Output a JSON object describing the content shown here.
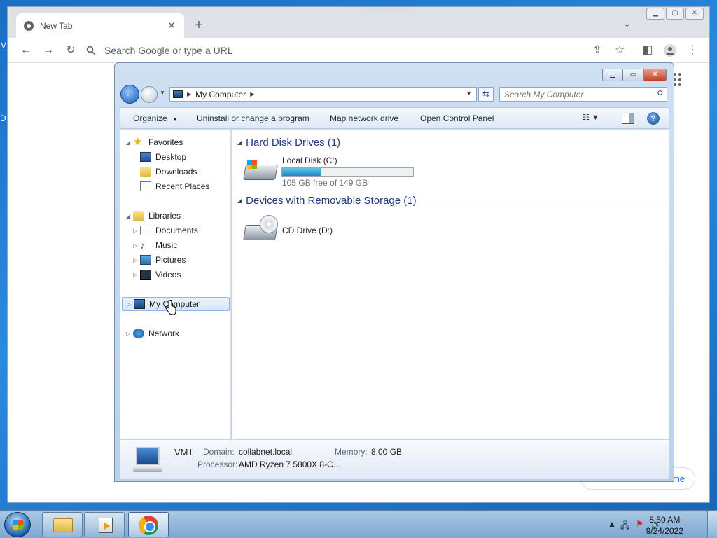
{
  "desktop": {
    "edge_letters": [
      "M",
      "D"
    ]
  },
  "chrome": {
    "tab_title": "New Tab",
    "omnibox_placeholder": "Search Google or type a URL",
    "customize_partial": "me"
  },
  "explorer": {
    "address": {
      "crumb": "My Computer"
    },
    "search_placeholder": "Search My Computer",
    "commands": {
      "organize": "Organize",
      "uninstall": "Uninstall or change a program",
      "map_drive": "Map network drive",
      "control_panel": "Open Control Panel"
    },
    "nav": {
      "favorites": "Favorites",
      "desktop": "Desktop",
      "downloads": "Downloads",
      "recent": "Recent Places",
      "libraries": "Libraries",
      "documents": "Documents",
      "music": "Music",
      "pictures": "Pictures",
      "videos": "Videos",
      "my_computer": "My Computer",
      "network": "Network"
    },
    "groups": {
      "hdd": "Hard Disk Drives (1)",
      "removable": "Devices with Removable Storage (1)"
    },
    "drives": {
      "c": {
        "name": "Local Disk (C:)",
        "free_text": "105 GB free of 149 GB",
        "used_fraction": 0.295
      },
      "d": {
        "name": "CD Drive (D:)"
      }
    },
    "details": {
      "computer_name": "VM1",
      "domain_label": "Domain:",
      "domain": "collabnet.local",
      "memory_label": "Memory:",
      "memory": "8.00 GB",
      "processor_label": "Processor:",
      "processor": "AMD Ryzen 7 5800X 8-C..."
    }
  },
  "taskbar": {
    "time": "8:50 AM",
    "date": "9/24/2022"
  },
  "colors": {
    "desktop": "#1a6fc4",
    "explorer_frame": "#cfe0f3",
    "group_heading": "#1f3b78",
    "drive_bar_fill": "#1b8bbd"
  }
}
